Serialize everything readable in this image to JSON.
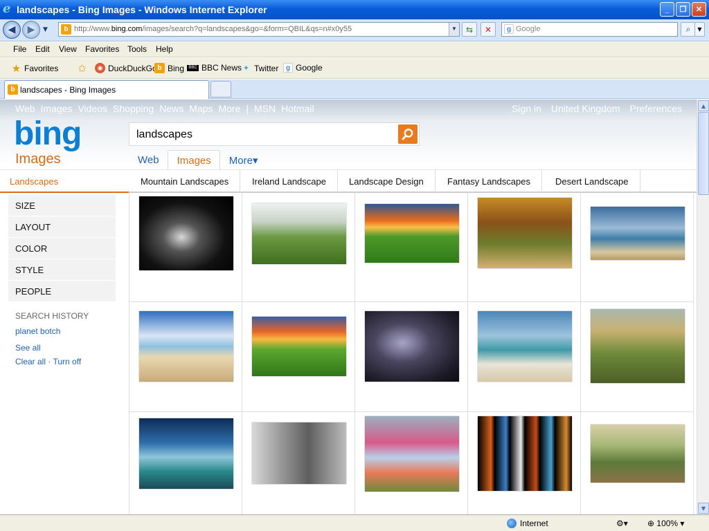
{
  "window": {
    "title": "landscapes - Bing Images - Windows Internet Explorer"
  },
  "address": {
    "prefix": "http://www.",
    "domain": "bing.com",
    "path": "/images/search?q=landscapes&go=&form=QBIL&qs=n#x0y55",
    "search_placeholder": "Google"
  },
  "menu": [
    "File",
    "Edit",
    "View",
    "Favorites",
    "Tools",
    "Help"
  ],
  "favorites": {
    "label": "Favorites",
    "links": [
      "DuckDuckGo",
      "Bing",
      "BBC News",
      "Twitter",
      "Google"
    ]
  },
  "tab": {
    "title": "landscapes - Bing Images"
  },
  "bing": {
    "topnav": [
      "Web",
      "Images",
      "Videos",
      "Shopping",
      "News",
      "Maps",
      "More",
      "|",
      "MSN",
      "Hotmail"
    ],
    "topnav_right": [
      "Sign in",
      "United Kingdom",
      "Preferences"
    ],
    "logo": "bing",
    "logo_sub": "Images",
    "query": "landscapes",
    "scopes": [
      "Web",
      "Images",
      "More▾"
    ],
    "current": "Landscapes",
    "related": [
      "Mountain Landscapes",
      "Ireland Landscape",
      "Landscape Design",
      "Fantasy Landscapes",
      "Desert Landscape"
    ],
    "filters": [
      "SIZE",
      "LAYOUT",
      "COLOR",
      "STYLE",
      "PEOPLE"
    ],
    "history": {
      "heading": "SEARCH HISTORY",
      "item": "planet botch",
      "see_all": "See all",
      "clear": "Clear all",
      "sep": " · ",
      "turn_off": "Turn off"
    }
  },
  "results": [
    {
      "name": "dark-forest",
      "bg": "radial-gradient(ellipse at 45% 55%,#d8d8d8 0%,#555 25%,#111 60%,#000 100%)"
    },
    {
      "name": "green-mountain",
      "bg": "linear-gradient(#eef2f0 0%,#c8d3c8 30%,#6d9a43 55%,#3f6e1d 100%)"
    },
    {
      "name": "sunset-field",
      "bg": "linear-gradient(#2c5a8f 0%,#e86a1f 28%,#f8c048 40%,#4d9a2a 55%,#2f7a18 100%)"
    },
    {
      "name": "autumn-cabin",
      "bg": "linear-gradient(#c78a28 0%,#8a5218 35%,#6e7b2c 65%,#d5b070 100%)"
    },
    {
      "name": "rainbow-beach",
      "bg": "linear-gradient(#3b6d9e 0%,#9bbad6 40%,#3e7ea8 60%,#d8c8a0 85%,#b59a6a 100%)"
    },
    {
      "name": "sandy-beach",
      "bg": "linear-gradient(#2e6fc0 0%,#d8e6f4 35%,#8fc0e0 50%,#e8d8b0 65%,#c9aa78 100%)"
    },
    {
      "name": "sunset-field-2",
      "bg": "linear-gradient(#3d5e9e 0%,#e5652a 25%,#f7b840 38%,#5ca82f 55%,#2e7618 100%)"
    },
    {
      "name": "lightning-storm",
      "bg": "radial-gradient(ellipse at 40% 45%,#a8a4c8 0%,#4a4660 35%,#1e1c28 75%,#0b0a10 100%)"
    },
    {
      "name": "tropical-palm",
      "bg": "linear-gradient(#4d86b8 0%,#9cc3dc 35%,#3f9aa8 55%,#e8e4d8 75%,#d7c8a8 100%)"
    },
    {
      "name": "painted-valley",
      "bg": "linear-gradient(#aab8b0 0%,#c8b070 30%,#6e8a3a 60%,#4c5e28 100%)"
    },
    {
      "name": "planet-lake",
      "bg": "linear-gradient(#0f2c55 0%,#2d6eab 35%,#8ec6dc 55%,#2a8a8c 75%,#1b4a58 100%)"
    },
    {
      "name": "stone-building",
      "bg": "linear-gradient(90deg,#d8d8d8 0%,#9a9a9a 30%,#5e5e5e 60%,#bcbcbc 100%)"
    },
    {
      "name": "flower-stream",
      "bg": "linear-gradient(#9ab0c0 0%,#d85a8a 35%,#b8d0e8 55%,#e87a5a 75%,#6e8a3a 100%)"
    },
    {
      "name": "colorful-panels",
      "bg": "linear-gradient(90deg,#000 0%,#d8601a 14%,#000 18%,#3d80c8 30%,#000 34%,#e8e8e8 46%,#000 50%,#c84a1a 62%,#000 66%,#4aa0d0 78%,#000 82%,#d88a30 94%,#000 100%)"
    },
    {
      "name": "garden-bridge",
      "bg": "linear-gradient(#d8d0a8 0%,#a8b878 35%,#5e7a3a 65%,#8a7448 100%)"
    }
  ],
  "status": {
    "zone": "Internet",
    "zoom": "100%"
  }
}
